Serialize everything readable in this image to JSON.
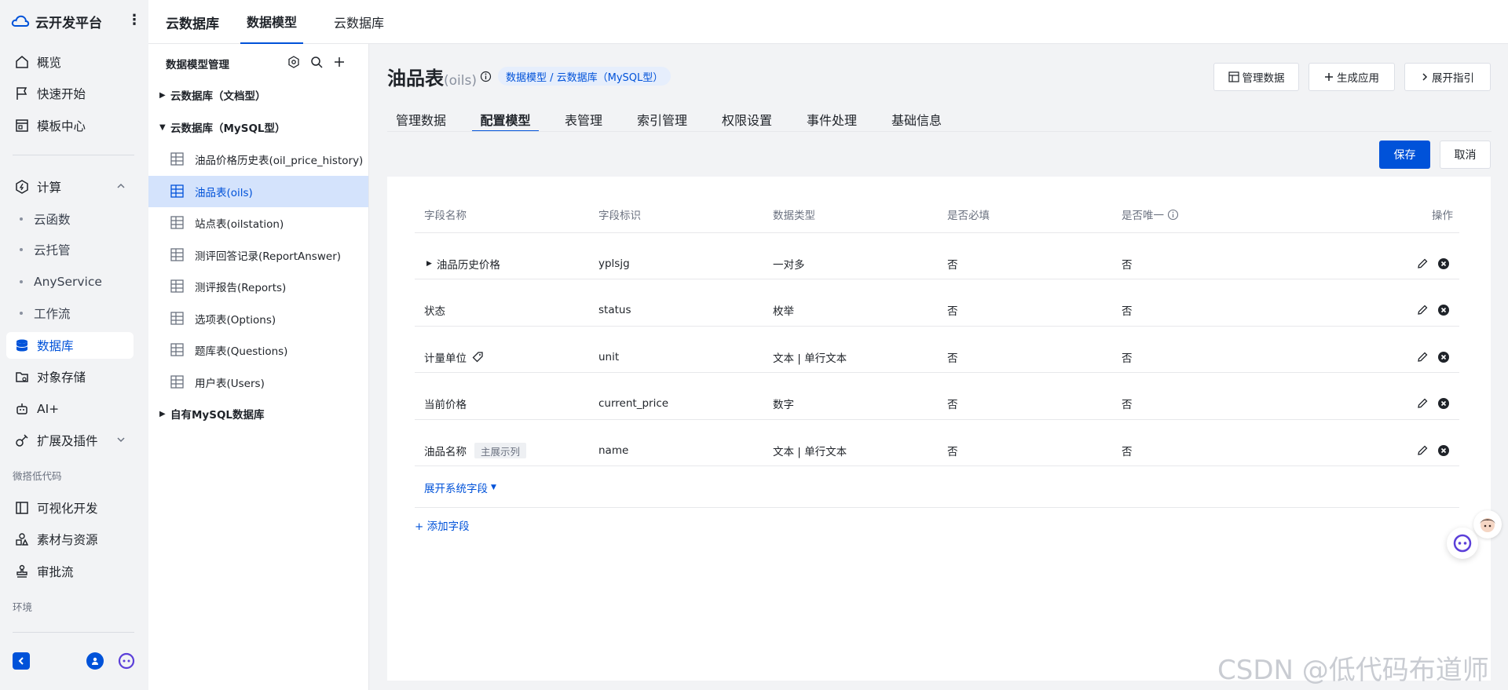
{
  "colors": {
    "accent": "#0052d9",
    "active_bg": "#d4e3fc",
    "page_bg": "#f2f3f5"
  },
  "brand": {
    "name": "云开发平台"
  },
  "nav": {
    "items": [
      {
        "label": "概览",
        "icon": "home-icon"
      },
      {
        "label": "快速开始",
        "icon": "flag-icon"
      },
      {
        "label": "模板中心",
        "icon": "template-icon"
      },
      {
        "label": "计算",
        "icon": "compute-icon"
      },
      {
        "label": "云函数"
      },
      {
        "label": "云托管"
      },
      {
        "label": "AnyService"
      },
      {
        "label": "工作流"
      },
      {
        "label": "数据库",
        "icon": "database-icon"
      },
      {
        "label": "对象存储",
        "icon": "storage-icon"
      },
      {
        "label": "AI+",
        "icon": "robot-icon"
      },
      {
        "label": "扩展及插件",
        "icon": "plugin-icon"
      },
      {
        "label": "可视化开发",
        "icon": "layout-icon"
      },
      {
        "label": "素材与资源",
        "icon": "shapes-icon"
      },
      {
        "label": "审批流",
        "icon": "stamp-icon"
      }
    ],
    "section_lowcode": "微搭低代码",
    "section_env": "环境"
  },
  "topbar": {
    "title": "云数据库",
    "tabs": [
      "数据模型",
      "云数据库"
    ]
  },
  "tree": {
    "title": "数据模型管理",
    "groups": [
      "云数据库（文档型）",
      "云数据库（MySQL型）",
      "自有MySQL数据库"
    ],
    "nodes": [
      "油品价格历史表(oil_price_history)",
      "油品表(oils)",
      "站点表(oilstation)",
      "测评回答记录(ReportAnswer)",
      "测评报告(Reports)",
      "选项表(Options)",
      "题库表(Questions)",
      "用户表(Users)"
    ]
  },
  "main": {
    "title": "油品表",
    "title_sub": "(oils)",
    "crumb": "数据模型 / 云数据库（MySQL型）",
    "buttons": {
      "manage": "管理数据",
      "generate": "生成应用",
      "guide": "展开指引"
    },
    "tabs": [
      "管理数据",
      "配置模型",
      "表管理",
      "索引管理",
      "权限设置",
      "事件处理",
      "基础信息"
    ],
    "save": "保存",
    "cancel": "取消",
    "table": {
      "headers": [
        "字段名称",
        "字段标识",
        "数据类型",
        "是否必填",
        "是否唯一",
        "操作"
      ],
      "rows": [
        {
          "name": "油品历史价格",
          "key": "yplsjg",
          "type": "一对多",
          "required": "否",
          "unique": "否"
        },
        {
          "name": "状态",
          "key": "status",
          "type": "枚举",
          "required": "否",
          "unique": "否"
        },
        {
          "name": "计量单位",
          "key": "unit",
          "type": "文本 | 单行文本",
          "required": "否",
          "unique": "否"
        },
        {
          "name": "当前价格",
          "key": "current_price",
          "type": "数字",
          "required": "否",
          "unique": "否"
        },
        {
          "name": "油品名称",
          "tag": "主展示列",
          "key": "name",
          "type": "文本 | 单行文本",
          "required": "否",
          "unique": "否"
        }
      ]
    },
    "expand_system": "展开系统字段",
    "add_field": "+ 添加字段"
  },
  "watermark": "CSDN @低代码布道师"
}
